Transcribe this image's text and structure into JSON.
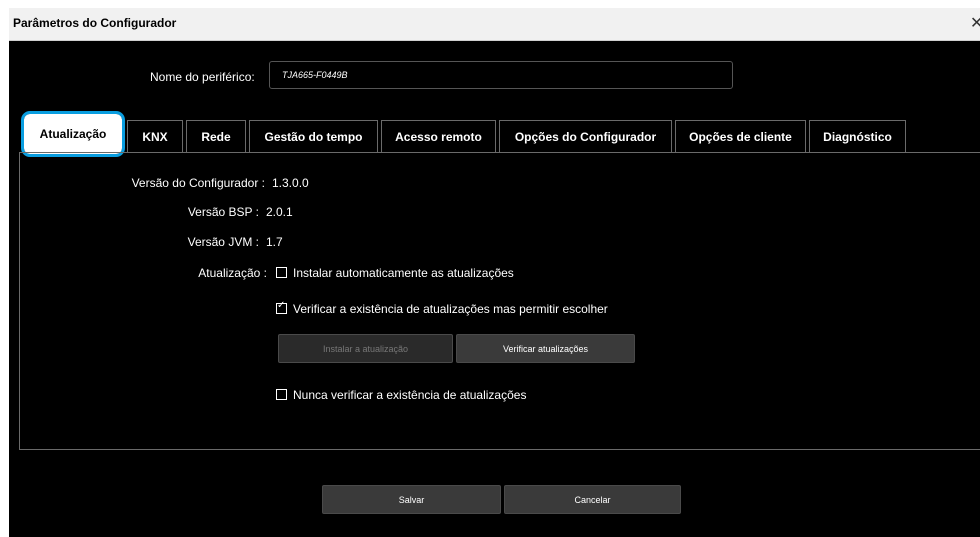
{
  "window": {
    "title": "Parâmetros do Configurador",
    "close_glyph": "✕"
  },
  "device": {
    "label": "Nome do periférico:",
    "value": "TJA665-F0449B"
  },
  "tabs": [
    {
      "label": "Atualização",
      "active": true
    },
    {
      "label": "KNX"
    },
    {
      "label": "Rede"
    },
    {
      "label": "Gestão do tempo"
    },
    {
      "label": "Acesso remoto"
    },
    {
      "label": "Opções do Configurador"
    },
    {
      "label": "Opções de cliente"
    },
    {
      "label": "Diagnóstico"
    }
  ],
  "update": {
    "configurator_version": {
      "label": "Versão do Configurador :",
      "value": "1.3.0.0"
    },
    "bsp_version": {
      "label": "Versão BSP :",
      "value": "2.0.1"
    },
    "jvm_version": {
      "label": "Versão JVM :",
      "value": "1.7"
    },
    "update_label": "Atualização :",
    "options": [
      {
        "label": "Instalar automaticamente as atualizações",
        "checked": false
      },
      {
        "label": "Verificar a existência de atualizações mas permitir escolher",
        "checked": true
      },
      {
        "label": "Nunca verificar a existência de atualizações",
        "checked": false
      }
    ],
    "install_button": "Instalar a atualização",
    "check_button": "Verificar atualizações"
  },
  "footer": {
    "save": "Salvar",
    "cancel": "Cancelar"
  },
  "colors": {
    "accent": "#0a9ee0",
    "background": "#000000",
    "titlebar": "#f1f1f1"
  }
}
